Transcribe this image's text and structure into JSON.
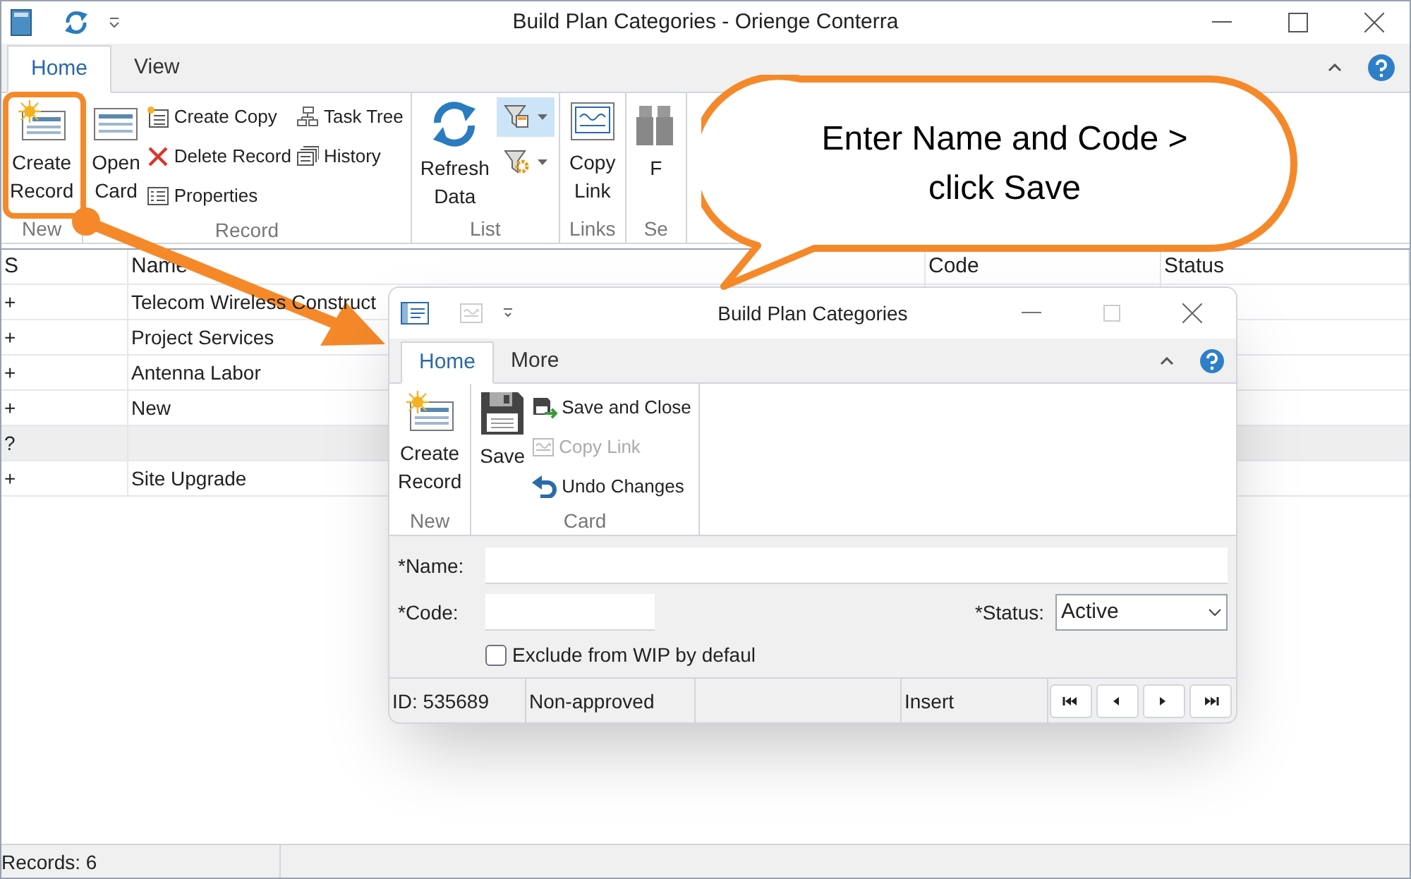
{
  "window": {
    "title": "Build Plan Categories - Orienge Conterra"
  },
  "tabs": [
    {
      "label": "Home",
      "selected": true
    },
    {
      "label": "View",
      "selected": false
    }
  ],
  "ribbon": [
    {
      "label": "New",
      "large": [
        {
          "label": "Create Record",
          "kind": "create",
          "highlighted": true
        }
      ]
    },
    {
      "label": "Record",
      "large": [
        {
          "label": "Open Card",
          "kind": "card"
        }
      ],
      "small_columns": [
        [
          {
            "label": "Create Copy",
            "kind": "copy"
          },
          {
            "label": "Delete Record",
            "kind": "delete"
          },
          {
            "label": "Properties",
            "kind": "properties"
          }
        ],
        [
          {
            "label": "Task Tree",
            "kind": "tree"
          },
          {
            "label": "History",
            "kind": "history"
          }
        ]
      ]
    },
    {
      "label": "List",
      "large": [
        {
          "label": "Refresh Data",
          "kind": "refresh"
        }
      ],
      "filters": [
        {
          "kind": "filter",
          "selected": true
        },
        {
          "kind": "filter-gear",
          "selected": false
        }
      ]
    },
    {
      "label": "Links",
      "large": [
        {
          "label": "Copy Link",
          "kind": "link"
        }
      ]
    },
    {
      "label": "Se",
      "large": [
        {
          "label": "F",
          "kind": "binoculars"
        }
      ]
    }
  ],
  "table": {
    "columns": [
      "S",
      "Name",
      "Code",
      "Status"
    ],
    "rows": [
      {
        "s": "+",
        "name": "Telecom Wireless Construct",
        "selected": false
      },
      {
        "s": "+",
        "name": "Project Services",
        "selected": false
      },
      {
        "s": "+",
        "name": "Antenna Labor",
        "selected": false
      },
      {
        "s": "+",
        "name": "New",
        "selected": false
      },
      {
        "s": "?",
        "selected": true
      },
      {
        "s": "+",
        "name": "Site Upgrade",
        "selected": false
      }
    ]
  },
  "status_bar": {
    "records": "Records: 6"
  },
  "dialog": {
    "title": "Build Plan Categories",
    "tabs": [
      {
        "label": "Home",
        "selected": true
      },
      {
        "label": "More",
        "selected": false
      }
    ],
    "ribbon": [
      {
        "label": "New",
        "large": [
          {
            "label": "Create Record",
            "kind": "create"
          }
        ]
      },
      {
        "label": "Card",
        "large": [
          {
            "label": "Save",
            "kind": "save"
          }
        ],
        "small_columns": [
          [
            {
              "label": "Save and Close",
              "kind": "save-close",
              "disabled": false
            },
            {
              "label": "Copy Link",
              "kind": "link-small",
              "disabled": true
            },
            {
              "label": "Undo Changes",
              "kind": "undo",
              "disabled": false
            }
          ]
        ]
      }
    ],
    "form": {
      "name_label": "*Name:",
      "code_label": "*Code:",
      "status_label": "*Status:",
      "status_value": "Active",
      "checkbox": {
        "label": "Exclude from WIP by defaul",
        "checked": false
      }
    },
    "status_bar": {
      "id": "ID: 535689",
      "approval": "Non-approved",
      "mode": "Insert"
    }
  },
  "callout": {
    "text": "Enter Name and Code > click Save"
  }
}
